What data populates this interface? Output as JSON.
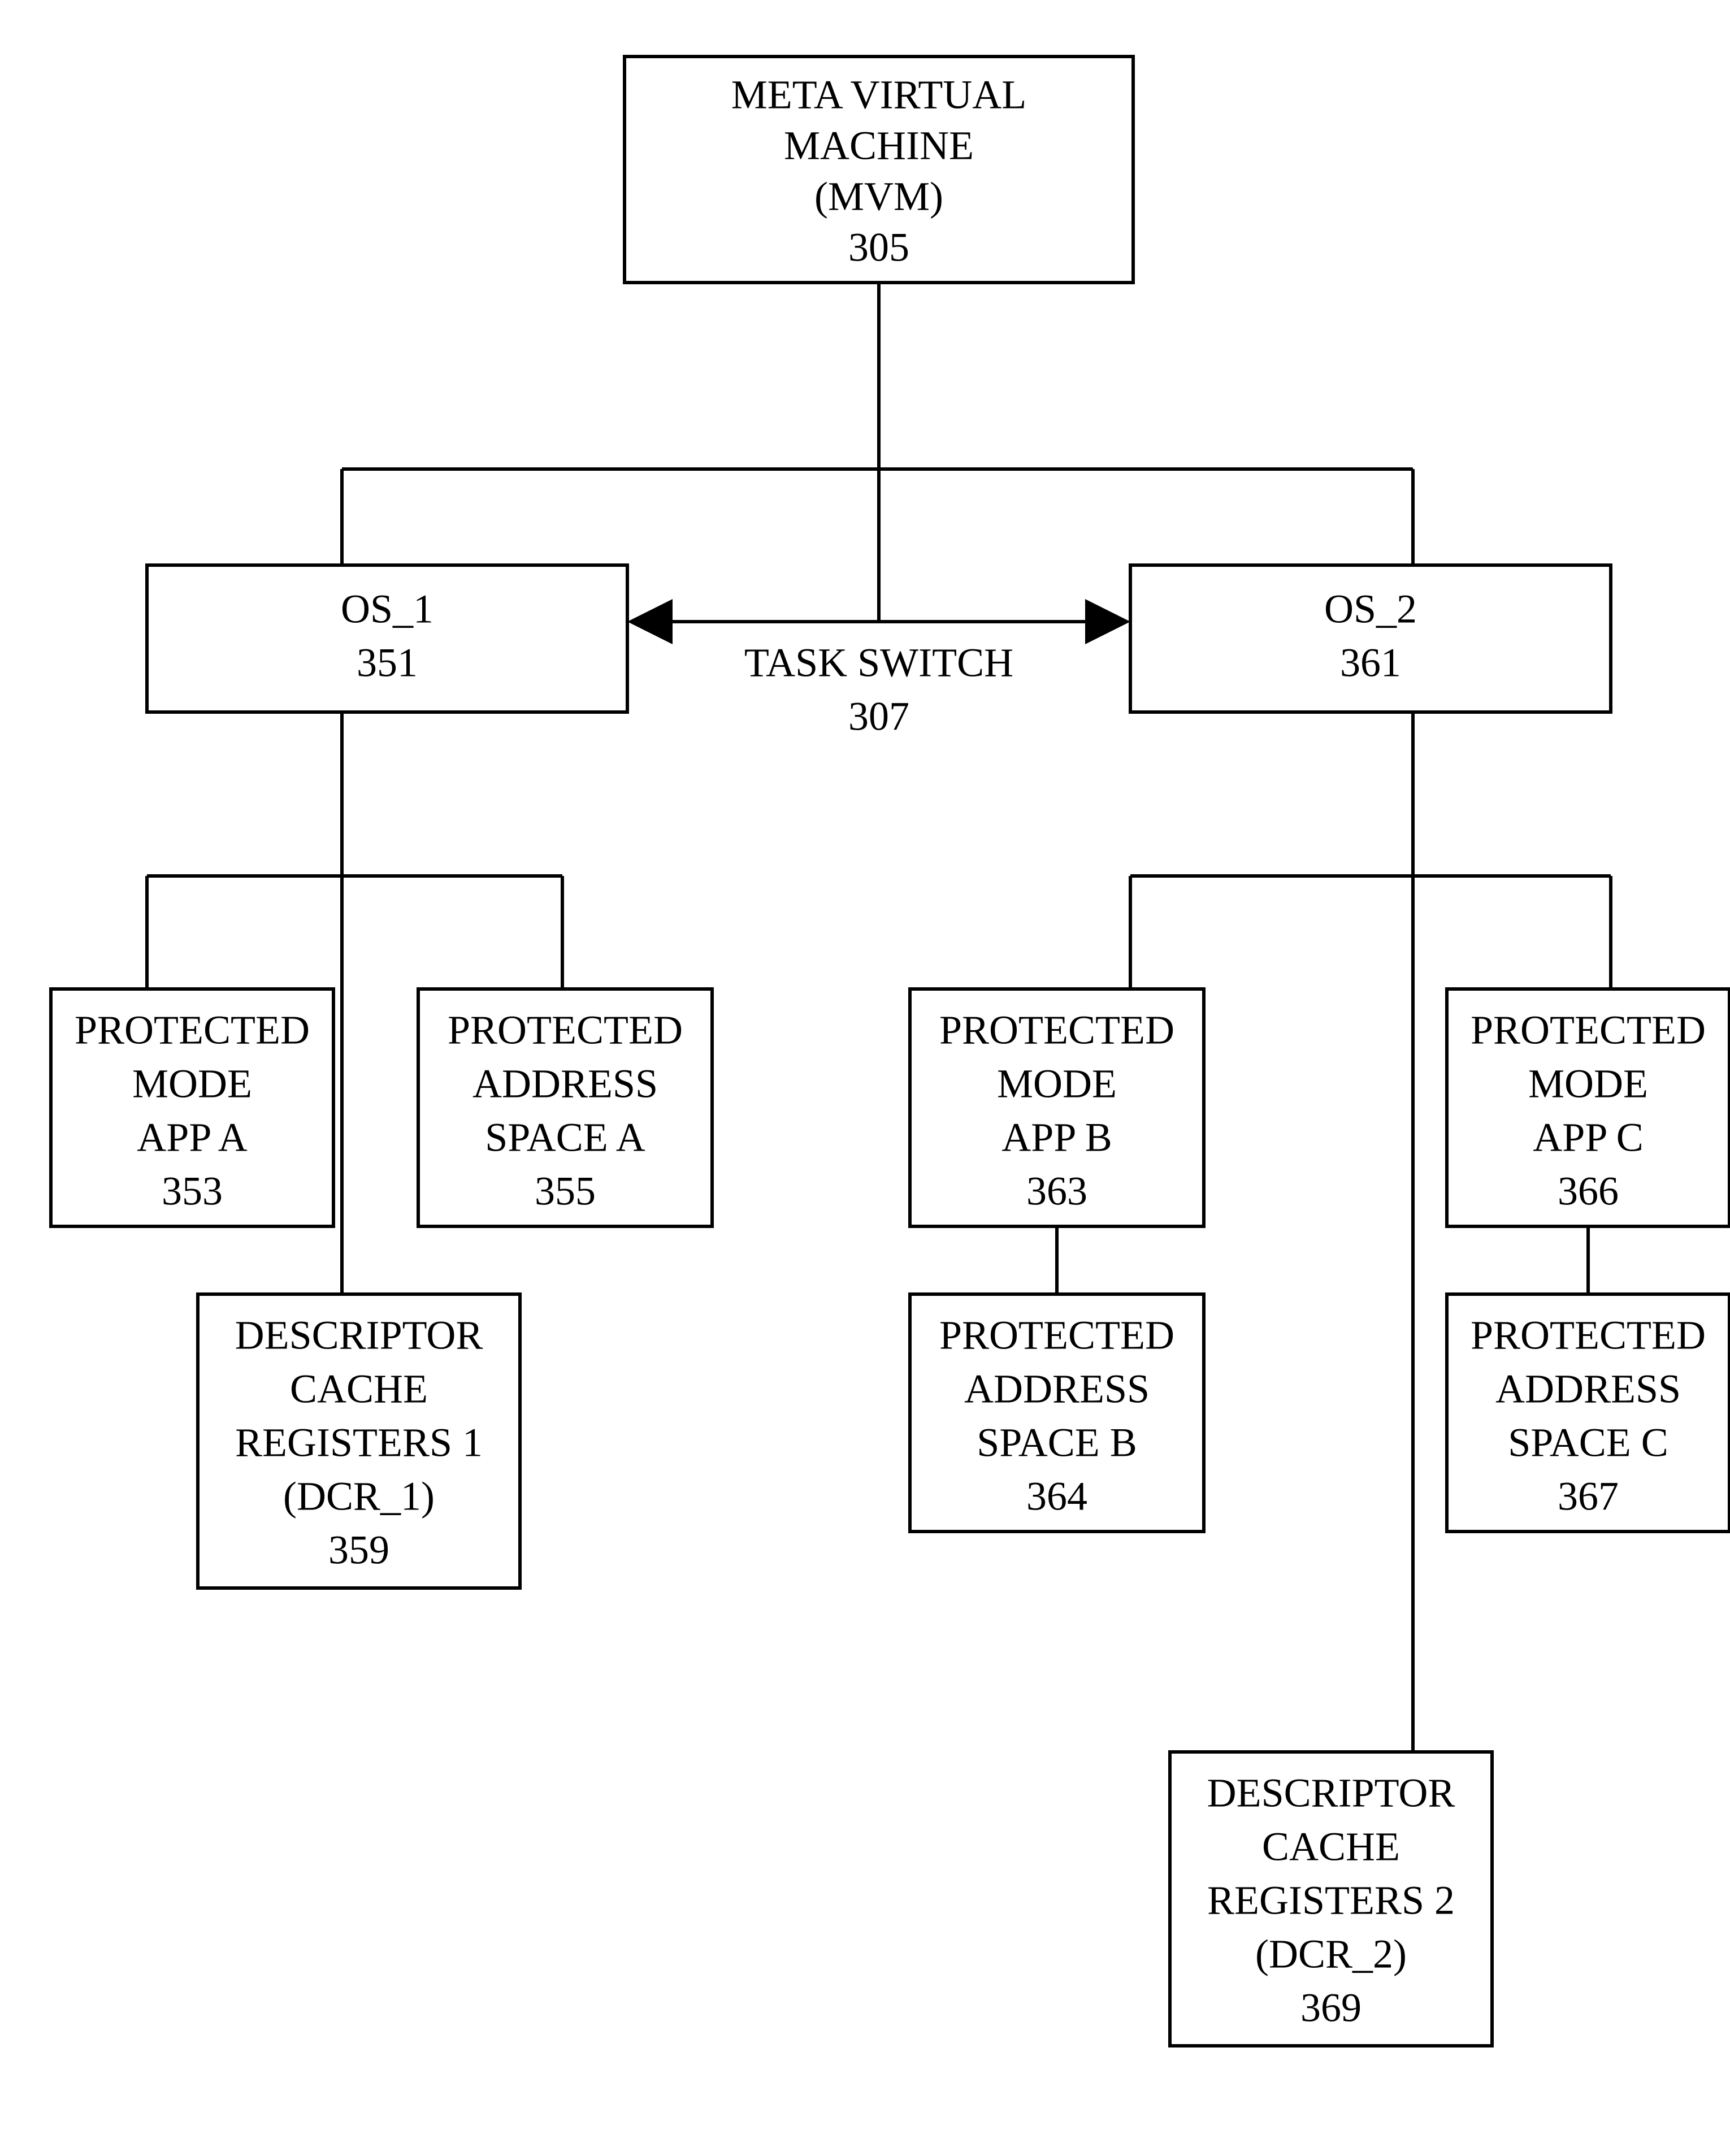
{
  "mvm": {
    "l1": "META VIRTUAL",
    "l2": "MACHINE",
    "l3": "(MVM)",
    "ref": "305"
  },
  "taskswitch": {
    "l1": "TASK SWITCH",
    "ref": "307"
  },
  "os1": {
    "l1": "OS_1",
    "ref": "351"
  },
  "os2": {
    "l1": "OS_2",
    "ref": "361"
  },
  "appA": {
    "l1": "PROTECTED",
    "l2": "MODE",
    "l3": "APP A",
    "ref": "353"
  },
  "spaceA": {
    "l1": "PROTECTED",
    "l2": "ADDRESS",
    "l3": "SPACE A",
    "ref": "355"
  },
  "dcr1": {
    "l1": "DESCRIPTOR",
    "l2": "CACHE",
    "l3": "REGISTERS 1",
    "l4": "(DCR_1)",
    "ref": "359"
  },
  "appB": {
    "l1": "PROTECTED",
    "l2": "MODE",
    "l3": "APP B",
    "ref": "363"
  },
  "spaceB": {
    "l1": "PROTECTED",
    "l2": "ADDRESS",
    "l3": "SPACE B",
    "ref": "364"
  },
  "appC": {
    "l1": "PROTECTED",
    "l2": "MODE",
    "l3": "APP C",
    "ref": "366"
  },
  "spaceC": {
    "l1": "PROTECTED",
    "l2": "ADDRESS",
    "l3": "SPACE C",
    "ref": "367"
  },
  "dcr2": {
    "l1": "DESCRIPTOR",
    "l2": "CACHE",
    "l3": "REGISTERS 2",
    "l4": "(DCR_2)",
    "ref": "369"
  }
}
